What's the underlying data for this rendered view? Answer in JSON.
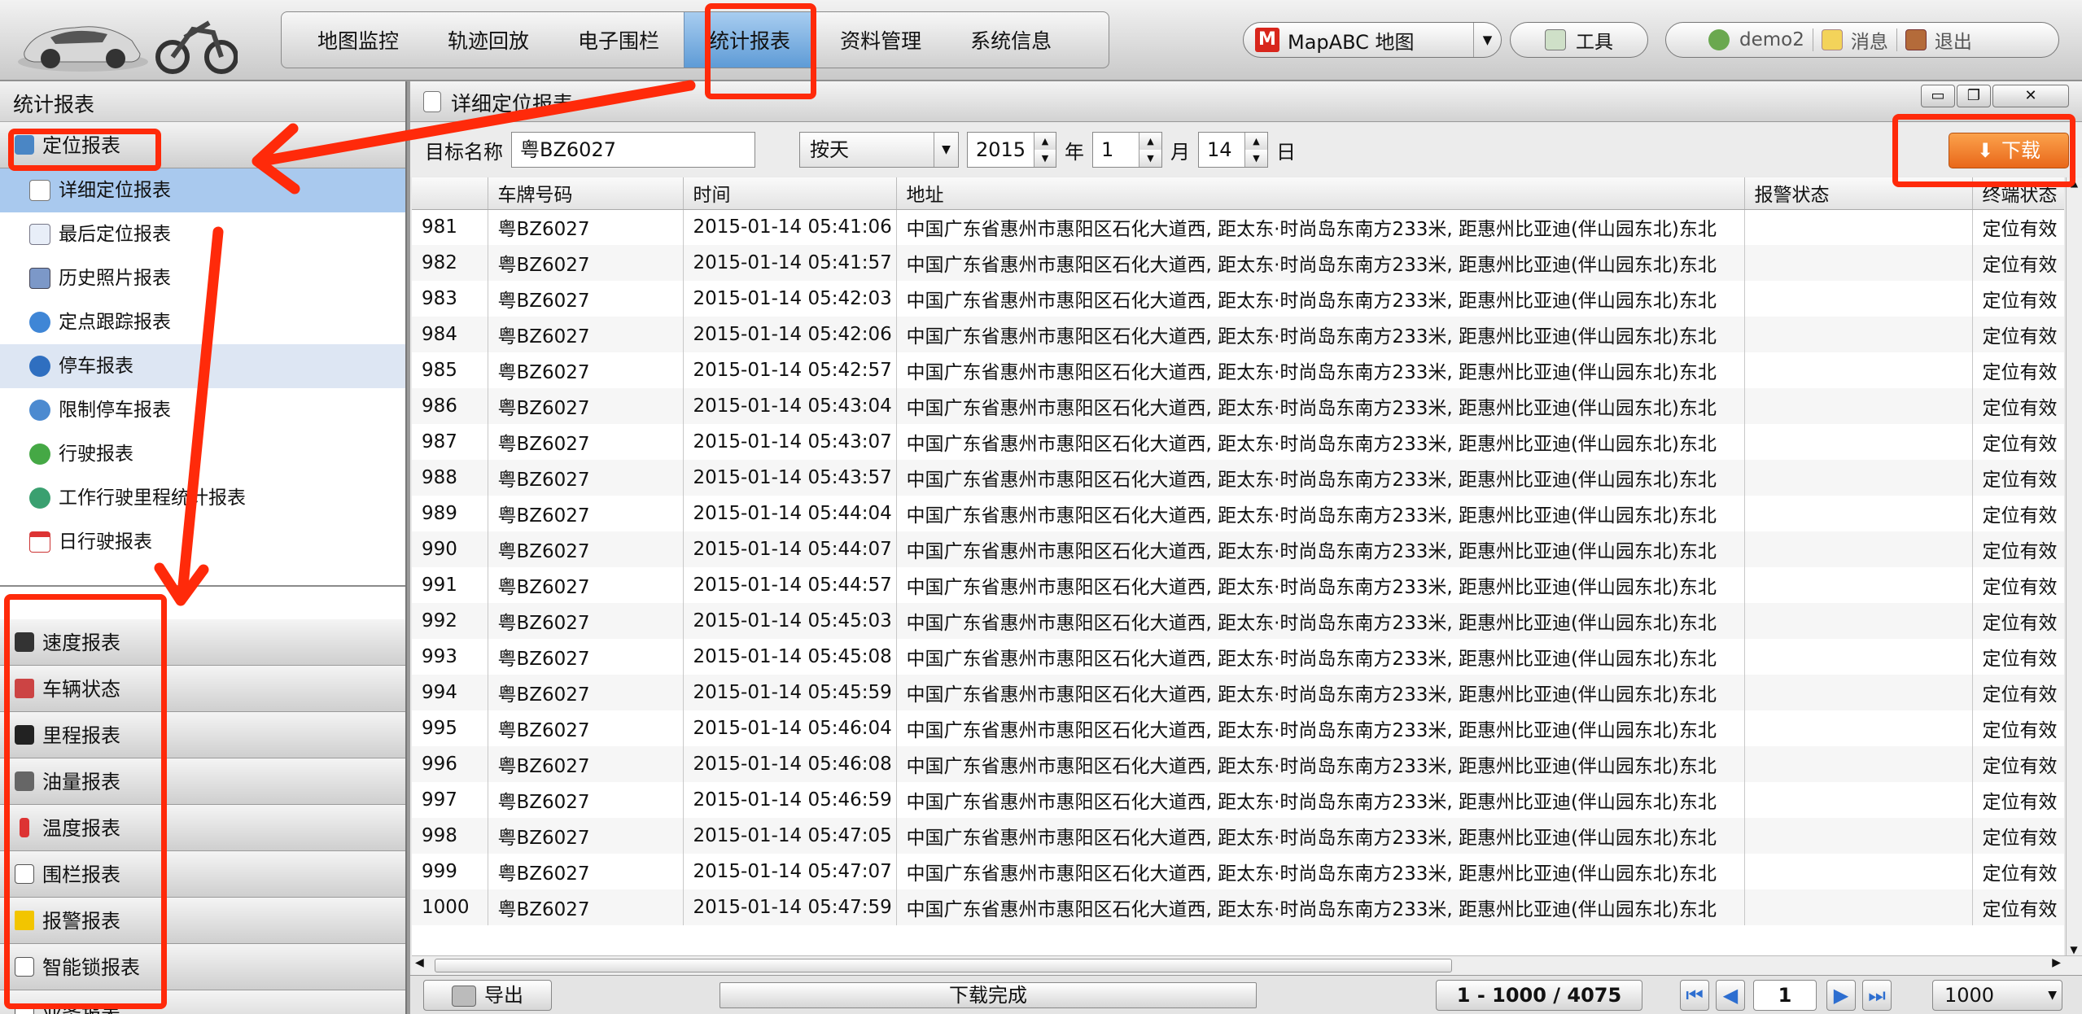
{
  "header": {
    "nav": [
      "地图监控",
      "轨迹回放",
      "电子围栏",
      "统计报表",
      "资料管理",
      "系统信息"
    ],
    "map_selector": "MapABC 地图",
    "map_logo": "M",
    "tools_label": "工具",
    "user": "demo2",
    "messages_label": "消息",
    "logout_label": "退出"
  },
  "sidebar": {
    "title": "统计报表",
    "open_group": "定位报表",
    "sub_items": [
      "详细定位报表",
      "最后定位报表",
      "历史照片报表",
      "定点跟踪报表",
      "停车报表",
      "限制停车报表",
      "行驶报表",
      "工作行驶里程统计报表",
      "日行驶报表"
    ],
    "groups": [
      "速度报表",
      "车辆状态",
      "里程报表",
      "油量报表",
      "温度报表",
      "围栏报表",
      "报警报表",
      "智能锁报表",
      "业务报表"
    ]
  },
  "panel": {
    "title": "详细定位报表",
    "target_label": "目标名称",
    "target_value": "粤BZ6027",
    "mode": "按天",
    "year": "2015",
    "year_unit": "年",
    "month": "1",
    "month_unit": "月",
    "day": "14",
    "day_unit": "日",
    "download": "下载"
  },
  "table": {
    "columns": [
      "",
      "车牌号码",
      "时间",
      "地址",
      "报警状态",
      "终端状态"
    ],
    "plate": "粤BZ6027",
    "address": "中国广东省惠州市惠阳区石化大道西, 距太东·时尚岛东南方233米, 距惠州比亚迪(伴山园东北)东北",
    "status": "定位有效",
    "rows": [
      [
        "981",
        "2015-01-14 05:41:06"
      ],
      [
        "982",
        "2015-01-14 05:41:57"
      ],
      [
        "983",
        "2015-01-14 05:42:03"
      ],
      [
        "984",
        "2015-01-14 05:42:06"
      ],
      [
        "985",
        "2015-01-14 05:42:57"
      ],
      [
        "986",
        "2015-01-14 05:43:04"
      ],
      [
        "987",
        "2015-01-14 05:43:07"
      ],
      [
        "988",
        "2015-01-14 05:43:57"
      ],
      [
        "989",
        "2015-01-14 05:44:04"
      ],
      [
        "990",
        "2015-01-14 05:44:07"
      ],
      [
        "991",
        "2015-01-14 05:44:57"
      ],
      [
        "992",
        "2015-01-14 05:45:03"
      ],
      [
        "993",
        "2015-01-14 05:45:08"
      ],
      [
        "994",
        "2015-01-14 05:45:59"
      ],
      [
        "995",
        "2015-01-14 05:46:04"
      ],
      [
        "996",
        "2015-01-14 05:46:08"
      ],
      [
        "997",
        "2015-01-14 05:46:59"
      ],
      [
        "998",
        "2015-01-14 05:47:05"
      ],
      [
        "999",
        "2015-01-14 05:47:07"
      ],
      [
        "1000",
        "2015-01-14 05:47:59"
      ]
    ]
  },
  "footer": {
    "export": "导出",
    "status": "下载完成",
    "range": "1 - 1000 / 4075",
    "page": "1",
    "page_size": "1000"
  },
  "colors": {
    "annotation": "#ff2a0a",
    "download_button": "#f0862e",
    "selected_row": "#a9c9ee"
  }
}
